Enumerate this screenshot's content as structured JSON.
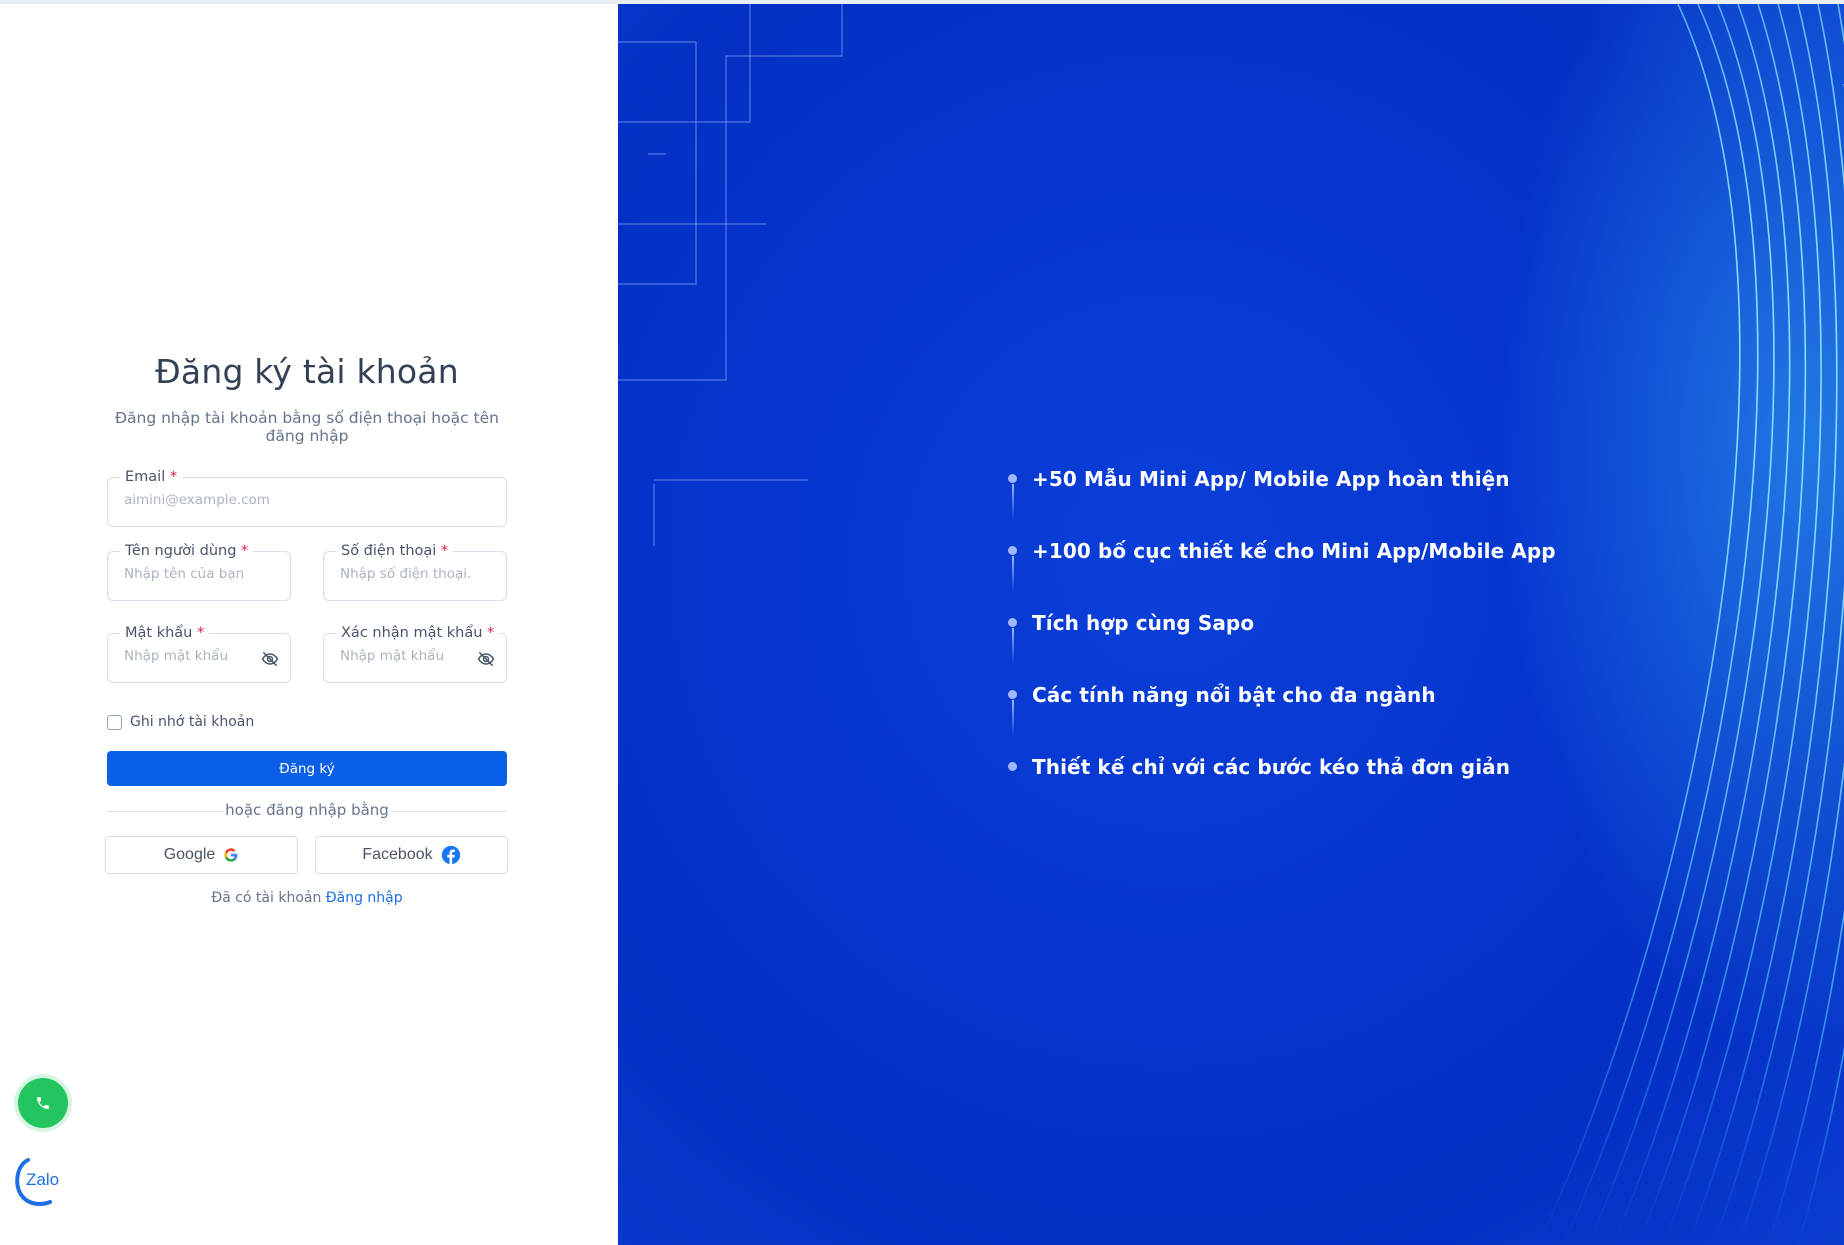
{
  "form": {
    "title": "Đăng ký tài khoản",
    "subtitle": "Đăng nhập tài khoản bằng số điện thoại hoặc tên đăng nhập",
    "email": {
      "label": "Email",
      "required_mark": "*",
      "placeholder": "aimini@example.com",
      "value": ""
    },
    "username": {
      "label": "Tên người dùng",
      "required_mark": "*",
      "placeholder": "Nhập tên của bạn",
      "value": ""
    },
    "phone": {
      "label": "Số điện thoại",
      "required_mark": "*",
      "placeholder": "Nhập số điện thoại.",
      "value": ""
    },
    "password": {
      "label": "Mật khẩu",
      "required_mark": "*",
      "placeholder": "Nhập mật khẩu",
      "value": "",
      "icon": "eye-off-icon"
    },
    "confirm_password": {
      "label": "Xác nhận mật khẩu",
      "required_mark": "*",
      "placeholder": "Nhập mật khẩu",
      "value": "",
      "icon": "eye-off-icon"
    },
    "remember_label": "Ghi nhớ tài khoản",
    "remember_checked": false,
    "submit_label": "Đăng ký",
    "divider_text": "hoặc đăng nhập bằng",
    "google_label": "Google",
    "facebook_label": "Facebook",
    "have_account_text": "Đã có tài khoản",
    "login_link": "Đăng nhập"
  },
  "floating": {
    "phone_icon": "phone-icon",
    "zalo_label": "Zalo"
  },
  "features": [
    {
      "text": "+50 Mẫu Mini App/ Mobile App hoàn thiện"
    },
    {
      "text": "+100 bố cục thiết kế cho Mini App/Mobile App"
    },
    {
      "text": "Tích hợp cùng Sapo"
    },
    {
      "text": "Các tính năng nổi bật cho đa ngành"
    },
    {
      "text": "Thiết kế chỉ với các bước kéo thả đơn giản"
    }
  ],
  "colors": {
    "primary": "#0a5fe6",
    "hero_bg": "#0636cf",
    "required": "#e11d48",
    "call_button": "#22c55e"
  }
}
